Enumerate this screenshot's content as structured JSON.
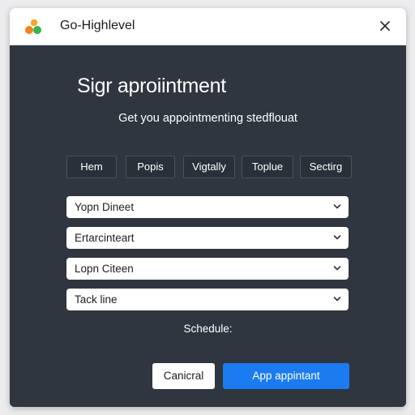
{
  "window": {
    "title": "Go-Highlevel"
  },
  "colors": {
    "logo_orange": "#f5821f",
    "logo_green": "#37b34a",
    "logo_yellow": "#f9a825",
    "primary_button": "#1a7cf0",
    "panel_background": "#2f3640"
  },
  "icons": {
    "logo": "go-highlevel-logo-icon",
    "close": "close-icon",
    "dropdown": "chevron-down-icon"
  },
  "dialog": {
    "heading": "Sigr aproiintment",
    "subheading": "Get you appointmenting stedflouat",
    "tabs": [
      {
        "label": "Hem"
      },
      {
        "label": "Popis"
      },
      {
        "label": "Vigtally"
      },
      {
        "label": "Toplue"
      },
      {
        "label": "Sectirg"
      }
    ],
    "selects": [
      {
        "value": "Yopn Dineet"
      },
      {
        "value": "Ertarcinteart"
      },
      {
        "value": "Lopn Citeen"
      },
      {
        "value": "Tack line"
      }
    ],
    "schedule_label": "Schedule:",
    "cancel_label": "Canicral",
    "submit_label": "App appintant"
  }
}
